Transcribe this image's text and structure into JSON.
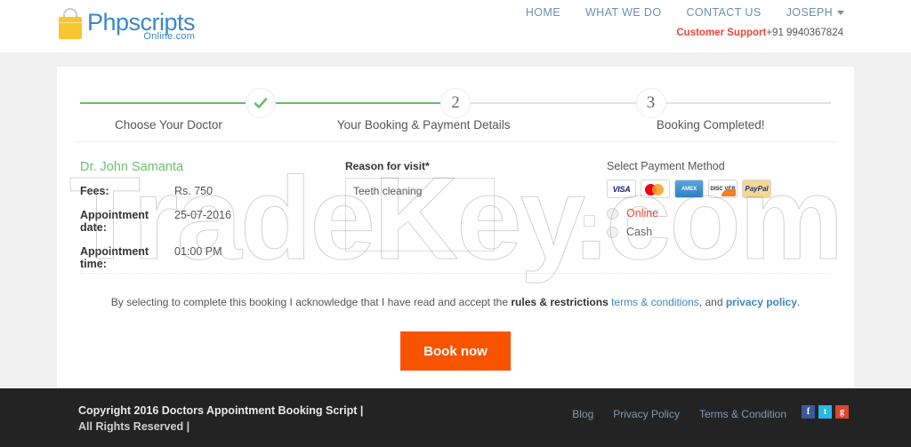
{
  "header": {
    "logo": {
      "main": "Phpscripts",
      "sub": "Online.com",
      "icon": "shopping-bag-icon"
    },
    "nav": [
      {
        "label": "HOME"
      },
      {
        "label": "WHAT WE DO"
      },
      {
        "label": "CONTACT US"
      },
      {
        "label": "JOSEPH"
      }
    ],
    "support": {
      "label": "Customer Support",
      "number": "+91 9940367824"
    }
  },
  "stepper": {
    "steps": [
      {
        "marker": "check",
        "label": "Choose Your Doctor",
        "state": "done"
      },
      {
        "marker": "2",
        "label": "Your Booking & Payment Details",
        "state": "active"
      },
      {
        "marker": "3",
        "label": "Booking Completed!",
        "state": "todo"
      }
    ]
  },
  "doctor": {
    "name": "Dr. John Samanta",
    "rows": [
      {
        "key": "Fees:",
        "value": "Rs. 750"
      },
      {
        "key": "Appointment date:",
        "value": "25-07-2016"
      },
      {
        "key": "Appointment time:",
        "value": "01:00 PM"
      }
    ]
  },
  "reason": {
    "label": "Reason for visit*",
    "value": "Teeth cleaning",
    "placeholder": "Reason for visit"
  },
  "payment": {
    "title": "Select Payment Method",
    "cards": [
      {
        "name": "visa-card-icon",
        "text": "VISA"
      },
      {
        "name": "mastercard-card-icon",
        "text": ""
      },
      {
        "name": "amex-card-icon",
        "text": "AMEX"
      },
      {
        "name": "discover-card-icon",
        "text": "DISC VER"
      },
      {
        "name": "paypal-card-icon",
        "text": "PayPal"
      }
    ],
    "options": [
      {
        "label": "Online",
        "selected": false
      },
      {
        "label": "Cash",
        "selected": false
      }
    ]
  },
  "terms": {
    "intro": "By selecting to complete this booking I acknowledge that I have read and accept the ",
    "rules": "rules & restrictions",
    "terms_link": "terms & conditions",
    "sep": ", and ",
    "privacy": "privacy policy",
    "end": "."
  },
  "actions": {
    "book_now": "Book now"
  },
  "footer": {
    "copyright_line1": "Copyright 2016 Doctors Appointment Booking Script |",
    "copyright_line2": "All Rights Reserved |",
    "links": [
      {
        "label": "Blog"
      },
      {
        "label": "Privacy Policy"
      },
      {
        "label": "Terms & Condition"
      }
    ],
    "social": [
      {
        "name": "facebook-icon",
        "glyph": "f"
      },
      {
        "name": "twitter-icon",
        "glyph": "t"
      },
      {
        "name": "googleplus-icon",
        "glyph": "g"
      }
    ]
  },
  "watermark": {
    "text": "TradeKey.com"
  },
  "colors": {
    "accent_orange": "#f85400",
    "link_blue": "#3b87c8",
    "brand_green": "#69bb6e",
    "support_red": "#e8453c"
  }
}
